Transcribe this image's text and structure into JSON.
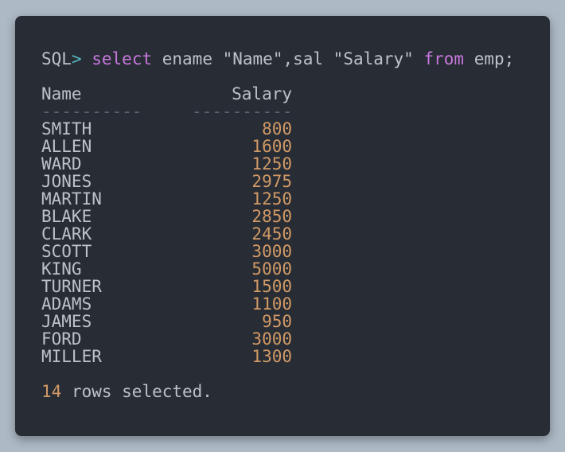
{
  "terminal": {
    "prompt": "SQL",
    "prompt_symbol": ">",
    "command": [
      {
        "text": "select",
        "kind": "keyword"
      },
      {
        "text": " ename \"Name\",sal \"Salary\" ",
        "kind": "plain"
      },
      {
        "text": "from",
        "kind": "keyword"
      },
      {
        "text": " emp;",
        "kind": "plain"
      }
    ],
    "headers": {
      "name": "Name",
      "salary": "Salary"
    },
    "separator": {
      "name": "----------",
      "salary": "----------"
    },
    "rows": [
      {
        "name": "SMITH",
        "salary": "800"
      },
      {
        "name": "ALLEN",
        "salary": "1600"
      },
      {
        "name": "WARD",
        "salary": "1250"
      },
      {
        "name": "JONES",
        "salary": "2975"
      },
      {
        "name": "MARTIN",
        "salary": "1250"
      },
      {
        "name": "BLAKE",
        "salary": "2850"
      },
      {
        "name": "CLARK",
        "salary": "2450"
      },
      {
        "name": "SCOTT",
        "salary": "3000"
      },
      {
        "name": "KING",
        "salary": "5000"
      },
      {
        "name": "TURNER",
        "salary": "1500"
      },
      {
        "name": "ADAMS",
        "salary": "1100"
      },
      {
        "name": "JAMES",
        "salary": "950"
      },
      {
        "name": "FORD",
        "salary": "3000"
      },
      {
        "name": "MILLER",
        "salary": "1300"
      }
    ],
    "footer": {
      "count": "14",
      "text": " rows selected."
    },
    "colors": {
      "background": "#282c34",
      "text": "#bdc2c9",
      "keyword": "#c678dd",
      "prompt_symbol": "#56b6c2",
      "number": "#d19a66",
      "separator": "#5c6370"
    }
  }
}
